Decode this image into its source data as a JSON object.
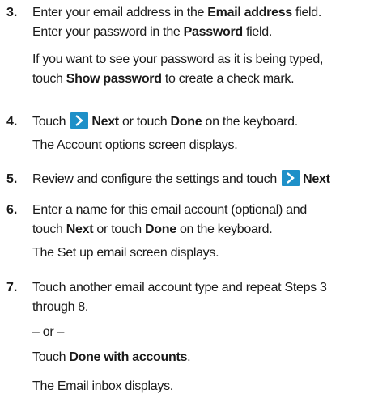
{
  "steps": [
    {
      "number": "3.",
      "line1_pre": "Enter your email address in the ",
      "line1_bold": "Email address",
      "line1_post": " field.",
      "line2_pre": "Enter your password in the ",
      "line2_bold": "Password",
      "line2_post": " field.",
      "line3": "If you want to see your password as it is being typed,",
      "line4_pre": "touch ",
      "line4_bold": "Show password",
      "line4_post": " to create a check mark."
    },
    {
      "number": "4.",
      "line1_pre": "Touch ",
      "line1_bold1": "Next",
      "line1_mid": " or touch ",
      "line1_bold2": "Done",
      "line1_post": " on the keyboard.",
      "line2": "The Account options screen displays."
    },
    {
      "number": "5.",
      "line1_pre": "Review and configure the settings and touch ",
      "line1_bold": "Next"
    },
    {
      "number": "6.",
      "line1": "Enter a name for this email account (optional) and",
      "line2_pre": "touch ",
      "line2_bold1": "Next",
      "line2_mid": " or touch ",
      "line2_bold2": "Done",
      "line2_post": " on the keyboard.",
      "line3": "The Set up email screen displays."
    },
    {
      "number": "7.",
      "line1": "Touch another email account type and repeat Steps 3",
      "line2": "through 8.",
      "line3": "– or –",
      "line4_pre": "Touch ",
      "line4_bold": "Done with accounts",
      "line4_post": ".",
      "line5": "The Email inbox displays."
    }
  ],
  "icons": {
    "next_arrow": "chevron-right-icon",
    "next_arrow_color": "#1e90c8"
  }
}
